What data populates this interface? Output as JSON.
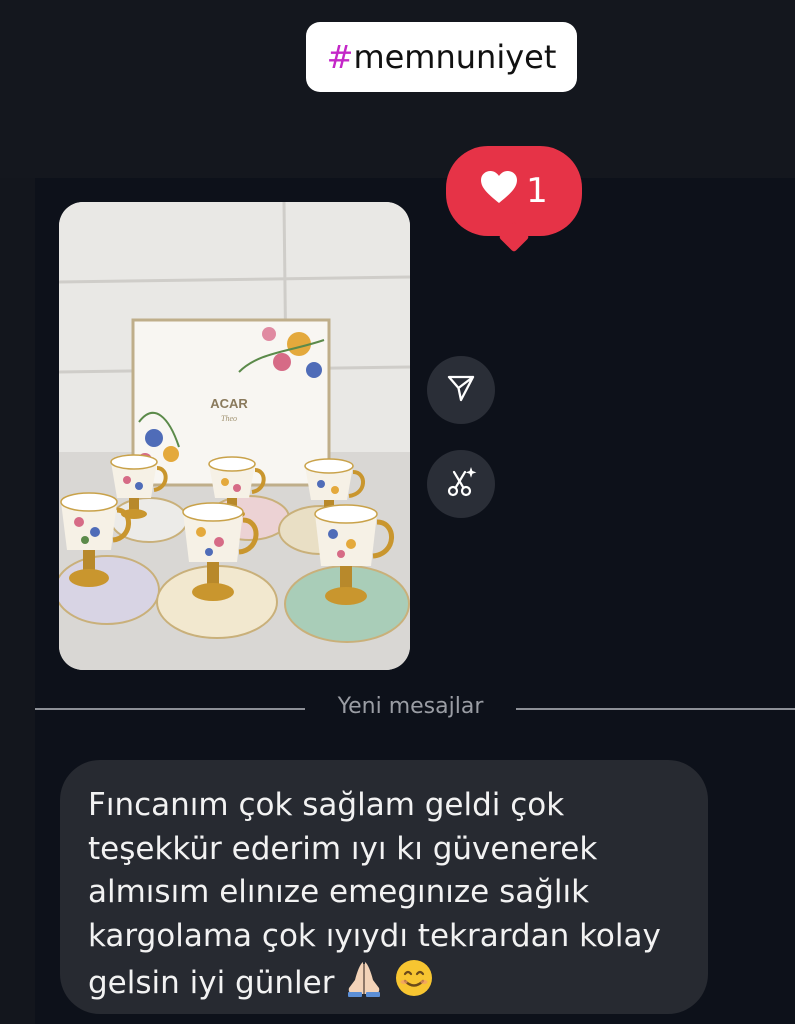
{
  "hashtag": {
    "label": "#memnuniyet"
  },
  "reaction": {
    "icon": "heart-icon",
    "count": "1",
    "color": "#e63347"
  },
  "photo": {
    "brand_text": "ACAR",
    "brand_sub": "Theo"
  },
  "actions": {
    "share_icon": "send-icon",
    "remix_icon": "scissors-sparkle-icon"
  },
  "divider": {
    "label": "Yeni mesajlar"
  },
  "message": {
    "lines": [
      "Fıncanım çok sağlam geldi çok",
      "teşekkür ederim ıyı kı güvenerek",
      "almısım elınıze emegınıze sağlık",
      "kargolama çok ıyıydı tekrardan kolay",
      "gelsin iyi günler"
    ],
    "emojis": [
      "folded-hands-emoji",
      "smiling-face-emoji"
    ]
  },
  "colors": {
    "background": "#0d111a",
    "bubble": "#272a31",
    "accent": "#c427c8"
  }
}
